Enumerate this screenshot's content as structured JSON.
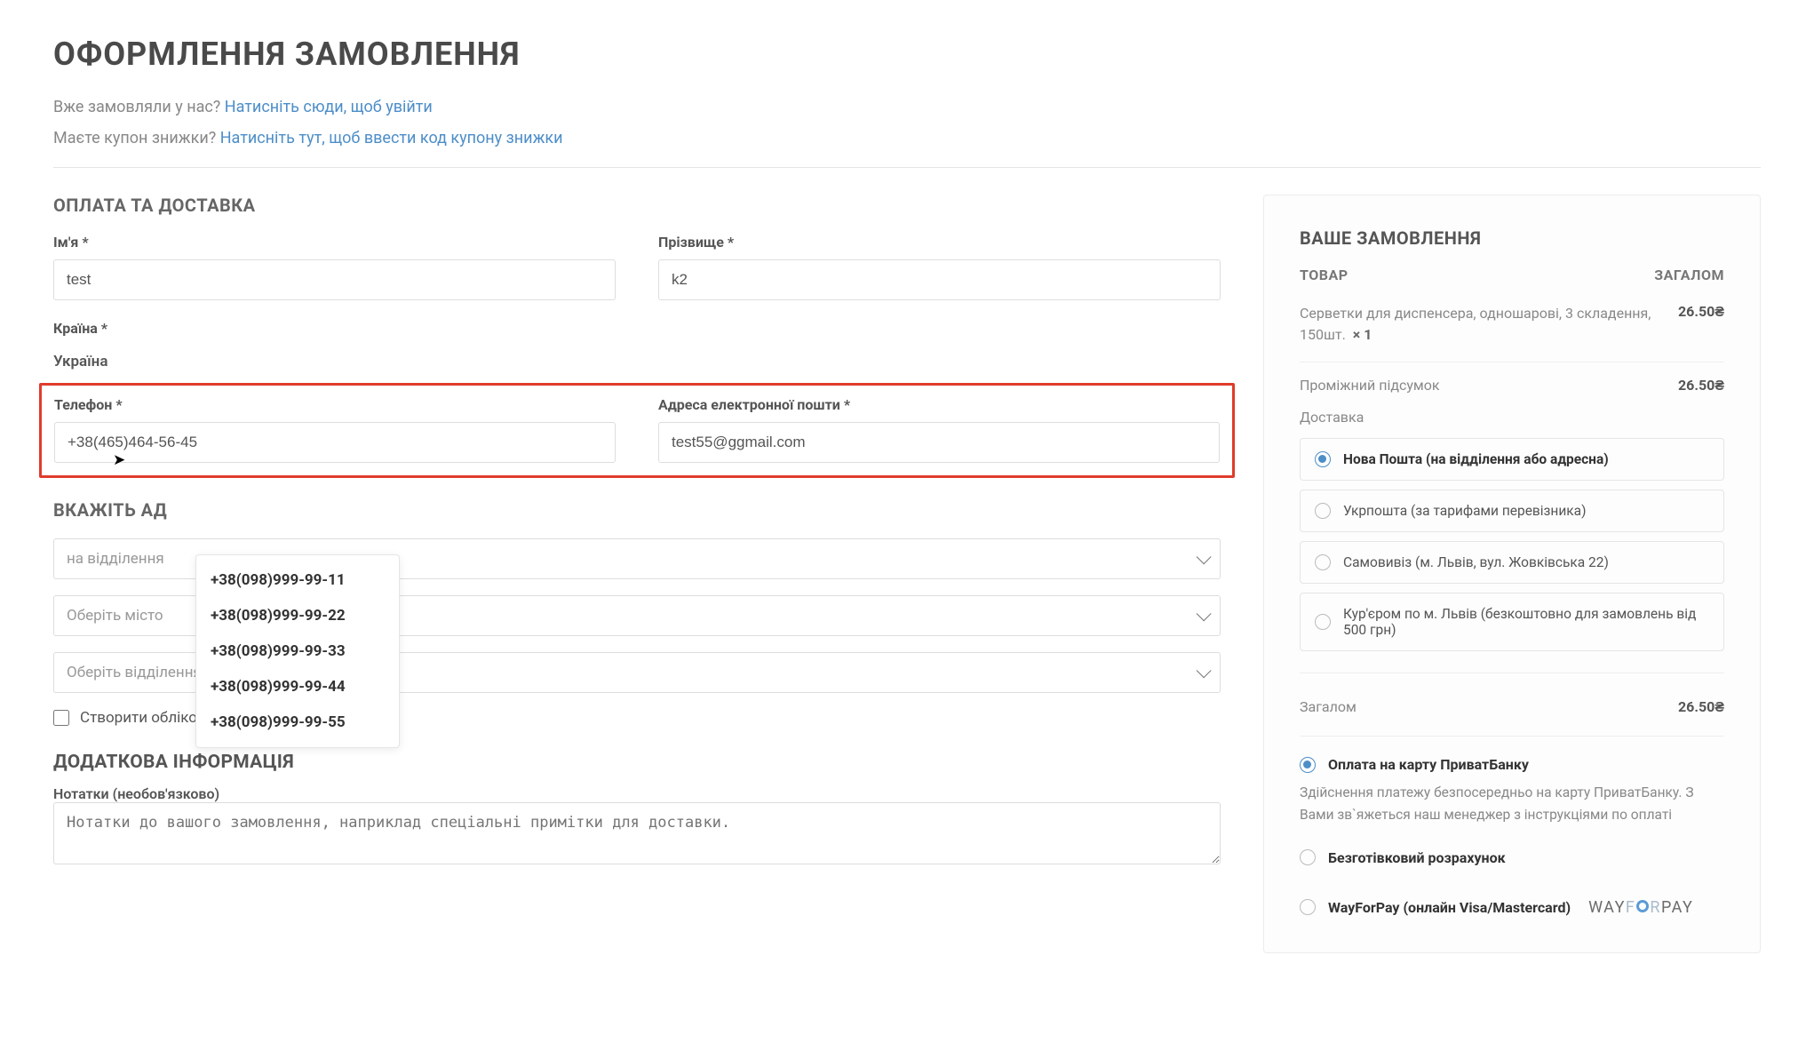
{
  "page": {
    "title": "ОФОРМЛЕННЯ ЗАМОВЛЕННЯ",
    "login_prompt": "Вже замовляли у нас?",
    "login_link": "Натисніть сюди, щоб увійти",
    "coupon_prompt": "Маєте купон знижки?",
    "coupon_link": "Натисніть тут, щоб ввести код купону знижки"
  },
  "billing": {
    "heading": "ОПЛАТА ТА ДОСТАВКА",
    "first_name_label": "Ім'я *",
    "first_name_value": "test",
    "last_name_label": "Прізвище *",
    "last_name_value": "k2",
    "country_label": "Країна *",
    "country_value": "Україна",
    "phone_label": "Телефон *",
    "phone_value": "+38(465)464-56-45",
    "email_label": "Адреса електронної пошти *",
    "email_value": "test55@ggmail.com",
    "autocomplete": [
      "+38(098)999-99-11",
      "+38(098)999-99-22",
      "+38(098)999-99-33",
      "+38(098)999-99-44",
      "+38(098)999-99-55"
    ]
  },
  "delivery": {
    "heading": "ВКАЖІТЬ АД",
    "type_placeholder": "на відділення",
    "city_placeholder": "Оберіть місто",
    "branch_placeholder": "Оберіть відділення"
  },
  "account": {
    "create_label": "Створити обліковий запис?"
  },
  "extra": {
    "heading": "ДОДАТКОВА ІНФОРМАЦІЯ",
    "notes_label": "Нотатки (необов'язково)",
    "notes_placeholder": "Нотатки до вашого замовлення, наприклад спеціальні примітки для доставки."
  },
  "order": {
    "heading": "ВАШЕ ЗАМОВЛЕННЯ",
    "col_product": "ТОВАР",
    "col_total": "ЗАГАЛОМ",
    "item_desc": "Серветки для диспенсера, одношарові, 3 складення, 150шт.",
    "item_qty": "× 1",
    "item_price": "26.50₴",
    "subtotal_label": "Проміжний підсумок",
    "subtotal_value": "26.50₴",
    "shipping_label": "Доставка",
    "shipping_options": [
      "Нова Пошта (на відділення або адресна)",
      "Укрпошта (за тарифами перевізника)",
      "Самовивіз (м. Львів, вул. Жовківська 22)",
      "Кур'єром по м. Львів (безкоштовно для замовлень від 500 грн)"
    ],
    "total_label": "Загалом",
    "total_value": "26.50₴"
  },
  "payment": {
    "options": [
      "Оплата на карту ПриватБанку",
      "Безготівковий розрахунок",
      "WayForPay (онлайн Visa/Mastercard)"
    ],
    "privat_desc": "Здійснення платежу безпосередньо на карту ПриватБанку. З Вами зв`яжеться наш менеджер з інструкціями по оплаті"
  }
}
